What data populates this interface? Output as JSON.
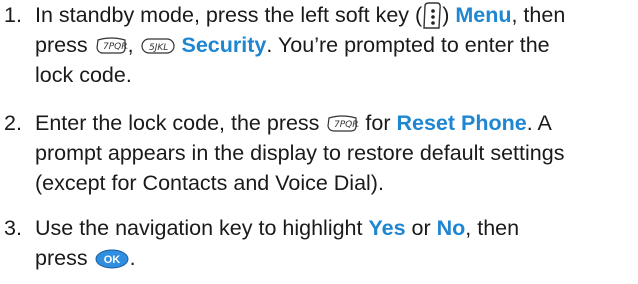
{
  "steps": [
    {
      "number": "1.",
      "lines": [
        [
          "In standby mode, press the left soft key (",
          ") ",
          "Menu",
          ", then"
        ],
        [
          "press ",
          ", ",
          "Security",
          ". You’re prompted to enter the"
        ],
        [
          "lock code."
        ]
      ],
      "keys": {
        "softkey": "left-soft-key-icon",
        "k7": "7PQRS",
        "k5": "5JKL"
      }
    },
    {
      "number": "2.",
      "lines": [
        [
          "Enter the lock code, the press ",
          " for ",
          "Reset Phone",
          ". A"
        ],
        [
          "prompt appears in the display to restore default settings"
        ],
        [
          "(except for Contacts and Voice Dial)."
        ]
      ],
      "keys": {
        "k7": "7PQRS"
      }
    },
    {
      "number": "3.",
      "lines": [
        [
          "Use the navigation key to highlight ",
          "Yes",
          " or ",
          "No",
          ", then"
        ],
        [
          "press ",
          "."
        ]
      ],
      "keys": {
        "ok": "OK"
      }
    }
  ],
  "colors": {
    "highlight": "#1f86d2",
    "text": "#1a1a1a",
    "ok_key": "#2f8ee0"
  }
}
